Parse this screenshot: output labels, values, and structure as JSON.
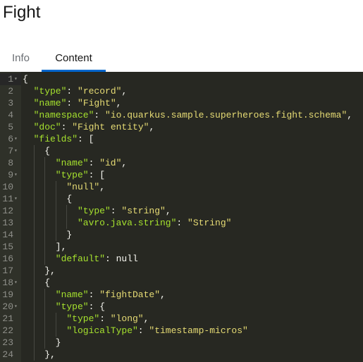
{
  "page": {
    "title": "Fight"
  },
  "tabs": [
    {
      "label": "Info",
      "active": false
    },
    {
      "label": "Content",
      "active": true
    }
  ],
  "editor": {
    "active_line": 1,
    "fold_icon": "fold-triangle-icon",
    "colors": {
      "background": "#272822",
      "key": "#a6e22e",
      "string": "#e6db74",
      "punctuation": "#f8f8f2",
      "line_number": "#8f908a"
    },
    "lines": [
      {
        "n": "1",
        "fold": true,
        "indent": 0,
        "tokens": [
          [
            "p",
            "{"
          ]
        ]
      },
      {
        "n": "2",
        "fold": false,
        "indent": 1,
        "tokens": [
          [
            "k",
            "\"type\""
          ],
          [
            "p",
            ": "
          ],
          [
            "s",
            "\"record\""
          ],
          [
            "p",
            ","
          ]
        ]
      },
      {
        "n": "3",
        "fold": false,
        "indent": 1,
        "tokens": [
          [
            "k",
            "\"name\""
          ],
          [
            "p",
            ": "
          ],
          [
            "s",
            "\"Fight\""
          ],
          [
            "p",
            ","
          ]
        ]
      },
      {
        "n": "4",
        "fold": false,
        "indent": 1,
        "tokens": [
          [
            "k",
            "\"namespace\""
          ],
          [
            "p",
            ": "
          ],
          [
            "s",
            "\"io.quarkus.sample.superheroes.fight.schema\""
          ],
          [
            "p",
            ","
          ]
        ]
      },
      {
        "n": "5",
        "fold": false,
        "indent": 1,
        "tokens": [
          [
            "k",
            "\"doc\""
          ],
          [
            "p",
            ": "
          ],
          [
            "s",
            "\"Fight entity\""
          ],
          [
            "p",
            ","
          ]
        ]
      },
      {
        "n": "6",
        "fold": true,
        "indent": 1,
        "tokens": [
          [
            "k",
            "\"fields\""
          ],
          [
            "p",
            ": ["
          ]
        ]
      },
      {
        "n": "7",
        "fold": true,
        "indent": 2,
        "tokens": [
          [
            "p",
            "{"
          ]
        ]
      },
      {
        "n": "8",
        "fold": false,
        "indent": 3,
        "tokens": [
          [
            "k",
            "\"name\""
          ],
          [
            "p",
            ": "
          ],
          [
            "s",
            "\"id\""
          ],
          [
            "p",
            ","
          ]
        ]
      },
      {
        "n": "9",
        "fold": true,
        "indent": 3,
        "tokens": [
          [
            "k",
            "\"type\""
          ],
          [
            "p",
            ": ["
          ]
        ]
      },
      {
        "n": "10",
        "fold": false,
        "indent": 4,
        "tokens": [
          [
            "s",
            "\"null\""
          ],
          [
            "p",
            ","
          ]
        ]
      },
      {
        "n": "11",
        "fold": true,
        "indent": 4,
        "tokens": [
          [
            "p",
            "{"
          ]
        ]
      },
      {
        "n": "12",
        "fold": false,
        "indent": 5,
        "tokens": [
          [
            "k",
            "\"type\""
          ],
          [
            "p",
            ": "
          ],
          [
            "s",
            "\"string\""
          ],
          [
            "p",
            ","
          ]
        ]
      },
      {
        "n": "13",
        "fold": false,
        "indent": 5,
        "tokens": [
          [
            "k",
            "\"avro.java.string\""
          ],
          [
            "p",
            ": "
          ],
          [
            "s",
            "\"String\""
          ]
        ]
      },
      {
        "n": "14",
        "fold": false,
        "indent": 4,
        "tokens": [
          [
            "p",
            "}"
          ]
        ]
      },
      {
        "n": "15",
        "fold": false,
        "indent": 3,
        "tokens": [
          [
            "p",
            "],"
          ]
        ]
      },
      {
        "n": "16",
        "fold": false,
        "indent": 3,
        "tokens": [
          [
            "k",
            "\"default\""
          ],
          [
            "p",
            ": "
          ],
          [
            "n",
            "null"
          ]
        ]
      },
      {
        "n": "17",
        "fold": false,
        "indent": 2,
        "tokens": [
          [
            "p",
            "},"
          ]
        ]
      },
      {
        "n": "18",
        "fold": true,
        "indent": 2,
        "tokens": [
          [
            "p",
            "{"
          ]
        ]
      },
      {
        "n": "19",
        "fold": false,
        "indent": 3,
        "tokens": [
          [
            "k",
            "\"name\""
          ],
          [
            "p",
            ": "
          ],
          [
            "s",
            "\"fightDate\""
          ],
          [
            "p",
            ","
          ]
        ]
      },
      {
        "n": "20",
        "fold": true,
        "indent": 3,
        "tokens": [
          [
            "k",
            "\"type\""
          ],
          [
            "p",
            ": {"
          ]
        ]
      },
      {
        "n": "21",
        "fold": false,
        "indent": 4,
        "tokens": [
          [
            "k",
            "\"type\""
          ],
          [
            "p",
            ": "
          ],
          [
            "s",
            "\"long\""
          ],
          [
            "p",
            ","
          ]
        ]
      },
      {
        "n": "22",
        "fold": false,
        "indent": 4,
        "tokens": [
          [
            "k",
            "\"logicalType\""
          ],
          [
            "p",
            ": "
          ],
          [
            "s",
            "\"timestamp-micros\""
          ]
        ]
      },
      {
        "n": "23",
        "fold": false,
        "indent": 3,
        "tokens": [
          [
            "p",
            "}"
          ]
        ]
      },
      {
        "n": "24",
        "fold": false,
        "indent": 2,
        "tokens": [
          [
            "p",
            "},"
          ]
        ]
      }
    ]
  }
}
